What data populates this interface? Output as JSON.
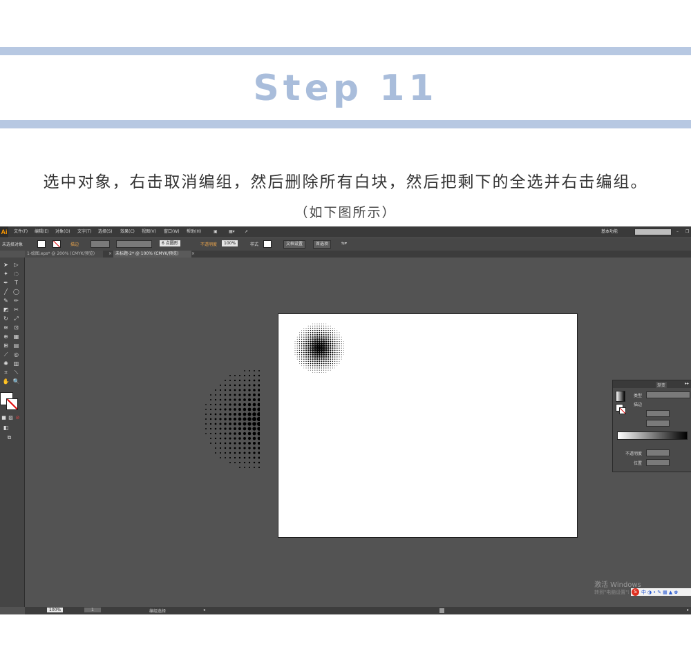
{
  "header": {
    "title": "Step 11",
    "instruction": "选中对象，右击取消编组，然后删除所有白块，然后把剩下的全选并右击编组。",
    "note": "（如下图所示）"
  },
  "colors": {
    "band": "#b7c8e2",
    "title": "#a9bddb",
    "app_bg": "#535353",
    "accent": "#ff9a00"
  },
  "app": {
    "logo": "Ai",
    "menu": [
      "文件(F)",
      "编辑(E)",
      "对象(O)",
      "文字(T)",
      "选择(S)",
      "效果(C)",
      "视图(V)",
      "窗口(W)",
      "帮助(H)"
    ],
    "workspace": "基本功能",
    "control": {
      "selection": "未选择对象",
      "stroke_label": "描边",
      "brush": "6 点圆形",
      "opacity_label": "不透明度",
      "opacity_value": "100%",
      "style_label": "样式",
      "doc_setup": "文档设置",
      "preferences": "首选项"
    },
    "tabs": [
      {
        "label": "1-绘图.eps* @ 200% (CMYK/预览)",
        "close": "×"
      },
      {
        "label": "未标题-2* @ 100% (CMYK/预览)",
        "close": "×"
      }
    ],
    "status": {
      "zoom": "100%",
      "page": "1",
      "mode": "编组选择"
    },
    "gradient_panel": {
      "tabs": "渐变",
      "type_label": "类型",
      "stroke_label": "描边",
      "opacity_label": "不透明度",
      "location_label": "位置"
    },
    "watermark": {
      "line1": "激活 Windows",
      "line2": "转到\"电脑设置\"以激活 Windows。"
    }
  }
}
